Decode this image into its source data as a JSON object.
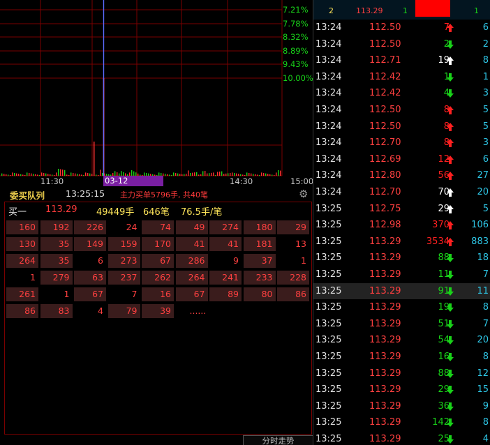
{
  "chart": {
    "pct_labels": [
      "7.21%",
      "7.78%",
      "8.32%",
      "8.89%",
      "9.43%",
      "10.00%"
    ],
    "time_labels": [
      "11:30",
      "14:30",
      "15:00"
    ],
    "cursor_time": "03-12 13:25:15"
  },
  "queue": {
    "title": "委买队列",
    "time": "13:25:15",
    "summary": "主力买单5796手, 共40笔",
    "bid": {
      "label": "买一",
      "price": "113.29",
      "volume": "49449手",
      "orders": "646笔",
      "avg": "76.5手/笔"
    },
    "rows": [
      [
        "160",
        "192",
        "226",
        "24",
        "74",
        "49",
        "274",
        "180",
        "29"
      ],
      [
        "130",
        "35",
        "149",
        "159",
        "170",
        "41",
        "41",
        "181",
        "13"
      ],
      [
        "264",
        "35",
        "6",
        "273",
        "67",
        "286",
        "9",
        "37",
        "1"
      ],
      [
        "1",
        "279",
        "63",
        "237",
        "262",
        "264",
        "241",
        "233",
        "228"
      ],
      [
        "261",
        "1",
        "67",
        "7",
        "16",
        "67",
        "89",
        "80",
        "86"
      ],
      [
        "86",
        "83",
        "4",
        "79",
        "39",
        "......"
      ]
    ],
    "row_bg": [
      [
        1,
        1,
        1,
        0,
        1,
        1,
        1,
        1,
        1
      ],
      [
        1,
        1,
        1,
        1,
        1,
        1,
        1,
        1,
        0
      ],
      [
        1,
        1,
        0,
        1,
        1,
        1,
        0,
        1,
        0
      ],
      [
        0,
        1,
        1,
        1,
        1,
        1,
        1,
        1,
        1
      ],
      [
        1,
        0,
        1,
        0,
        1,
        1,
        1,
        1,
        1
      ],
      [
        1,
        1,
        0,
        1,
        1,
        0
      ]
    ]
  },
  "bottom_tab": "分时走势",
  "ticks_header": {
    "a": "2",
    "b": "113.29",
    "c": "1",
    "d": "1"
  },
  "ticks": [
    {
      "time": "13:24",
      "price": "112.50",
      "vol": "7",
      "dir": "up-red",
      "extra": "6"
    },
    {
      "time": "13:24",
      "price": "112.50",
      "vol": "2",
      "dir": "down-green",
      "extra": "2"
    },
    {
      "time": "13:24",
      "price": "112.71",
      "vol": "19",
      "dir": "up-white",
      "extra": "8"
    },
    {
      "time": "13:24",
      "price": "112.42",
      "vol": "1",
      "dir": "down-green",
      "extra": "1"
    },
    {
      "time": "13:24",
      "price": "112.42",
      "vol": "4",
      "dir": "down-green",
      "extra": "3"
    },
    {
      "time": "13:24",
      "price": "112.50",
      "vol": "8",
      "dir": "up-red",
      "extra": "5"
    },
    {
      "time": "13:24",
      "price": "112.50",
      "vol": "8",
      "dir": "up-red",
      "extra": "5"
    },
    {
      "time": "13:24",
      "price": "112.70",
      "vol": "8",
      "dir": "up-red",
      "extra": "3"
    },
    {
      "time": "13:24",
      "price": "112.69",
      "vol": "12",
      "dir": "up-red",
      "extra": "6"
    },
    {
      "time": "13:24",
      "price": "112.80",
      "vol": "56",
      "dir": "up-red",
      "extra": "27"
    },
    {
      "time": "13:24",
      "price": "112.70",
      "vol": "70",
      "dir": "up-white",
      "extra": "20"
    },
    {
      "time": "13:25",
      "price": "112.75",
      "vol": "29",
      "dir": "up-white",
      "extra": "5"
    },
    {
      "time": "13:25",
      "price": "112.98",
      "vol": "370",
      "dir": "up-red",
      "extra": "106"
    },
    {
      "time": "13:25",
      "price": "113.29",
      "vol": "3534",
      "dir": "up-red",
      "extra": "883"
    },
    {
      "time": "13:25",
      "price": "113.29",
      "vol": "88",
      "dir": "down-green",
      "extra": "18"
    },
    {
      "time": "13:25",
      "price": "113.29",
      "vol": "11",
      "dir": "down-green",
      "extra": "7"
    },
    {
      "time": "13:25",
      "price": "113.29",
      "vol": "91",
      "dir": "down-green",
      "extra": "11",
      "highlight": true
    },
    {
      "time": "13:25",
      "price": "113.29",
      "vol": "19",
      "dir": "down-green",
      "extra": "8"
    },
    {
      "time": "13:25",
      "price": "113.29",
      "vol": "51",
      "dir": "down-green",
      "extra": "7"
    },
    {
      "time": "13:25",
      "price": "113.29",
      "vol": "54",
      "dir": "down-green",
      "extra": "20"
    },
    {
      "time": "13:25",
      "price": "113.29",
      "vol": "16",
      "dir": "down-green",
      "extra": "8"
    },
    {
      "time": "13:25",
      "price": "113.29",
      "vol": "88",
      "dir": "down-green",
      "extra": "12"
    },
    {
      "time": "13:25",
      "price": "113.29",
      "vol": "29",
      "dir": "down-green",
      "extra": "15"
    },
    {
      "time": "13:25",
      "price": "113.29",
      "vol": "36",
      "dir": "down-green",
      "extra": "9"
    },
    {
      "time": "13:25",
      "price": "113.29",
      "vol": "142",
      "dir": "down-green",
      "extra": "8"
    },
    {
      "time": "13:25",
      "price": "113.29",
      "vol": "25",
      "dir": "down-green",
      "extra": "4"
    }
  ],
  "colors": {
    "up": "#ff2020",
    "down": "#19d219",
    "white": "#ffffff",
    "grid": "#7a0000"
  }
}
